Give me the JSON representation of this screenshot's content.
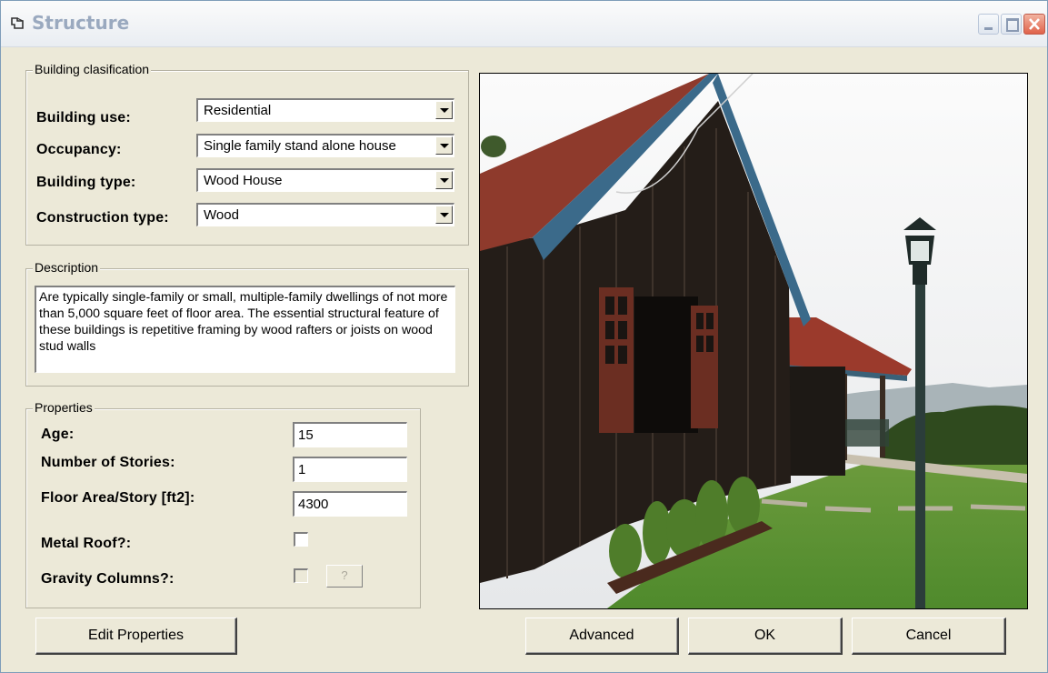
{
  "window": {
    "title": "Structure"
  },
  "groups": {
    "classification": "Building clasification",
    "description": "Description",
    "properties": "Properties"
  },
  "classification": {
    "building_use": {
      "label": "Building use:",
      "value": "Residential"
    },
    "occupancy": {
      "label": "Occupancy:",
      "value": "Single family stand alone house"
    },
    "building_type": {
      "label": "Building type:",
      "value": "Wood House"
    },
    "construction_type": {
      "label": "Construction type:",
      "value": "Wood"
    }
  },
  "description_text": "Are typically single-family or small, multiple-family dwellings of not more than 5,000 square feet of floor area. The essential structural feature of these buildings is repetitive framing by wood rafters or joists on wood stud walls",
  "properties": {
    "age": {
      "label": "Age:",
      "value": "15"
    },
    "stories": {
      "label": "Number of Stories:",
      "value": "1"
    },
    "floor_area": {
      "label": "Floor Area/Story [ft2]:",
      "value": "4300"
    },
    "metal_roof": {
      "label": "Metal Roof?:",
      "checked": false
    },
    "gravity_columns": {
      "label": "Gravity Columns?:",
      "checked": false,
      "enabled": false,
      "help_label": "?"
    }
  },
  "buttons": {
    "edit_properties": "Edit Properties",
    "advanced": "Advanced",
    "ok": "OK",
    "cancel": "Cancel"
  },
  "colors": {
    "dialog_bg": "#ece9d8",
    "close_button": "#e0624a",
    "roof": "#8e3a2c",
    "wall": "#2a211c",
    "grass": "#5d8f34"
  }
}
